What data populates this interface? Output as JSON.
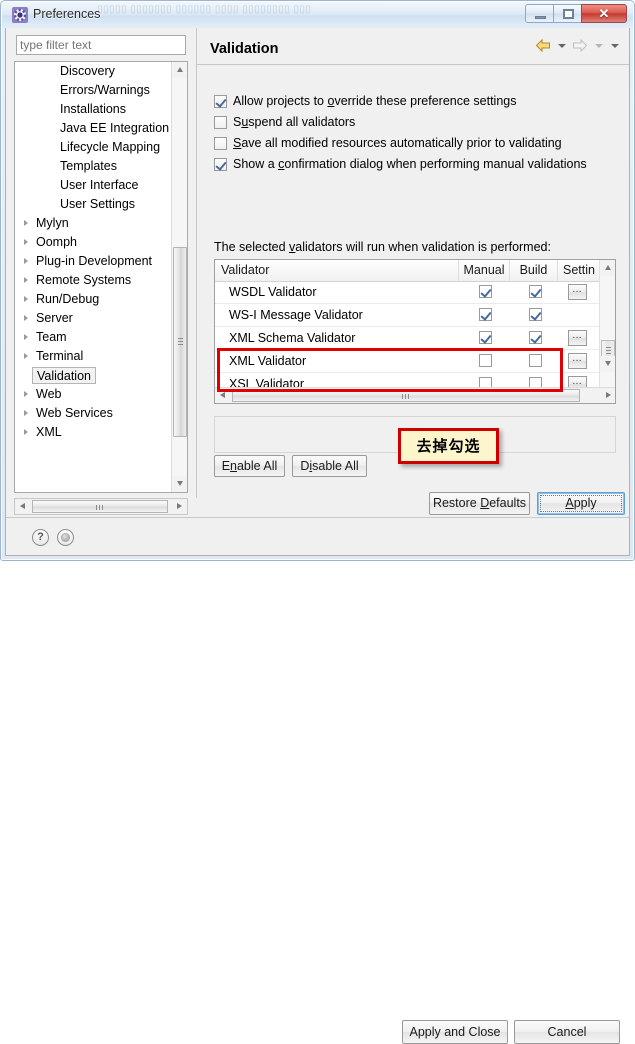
{
  "window": {
    "title": "Preferences",
    "icon": "preferences-gear-icon",
    "ghost_text": "▯▯▯▯▯ ▯▯▯▯▯▯▯ ▯▯▯▯▯▯ ▯▯▯▯ ▯▯▯▯▯▯▯▯ ▯▯▯",
    "controls": {
      "minimize": "minimize-icon",
      "maximize": "maximize-icon",
      "close": "✕"
    },
    "close_color": "#c43a31"
  },
  "filter": {
    "placeholder": "type filter text",
    "value": ""
  },
  "tree": {
    "items": [
      {
        "label": "Discovery",
        "level": "child",
        "expandable": false,
        "selected": false
      },
      {
        "label": "Errors/Warnings",
        "level": "child",
        "expandable": false,
        "selected": false
      },
      {
        "label": "Installations",
        "level": "child",
        "expandable": false,
        "selected": false
      },
      {
        "label": "Java EE Integration",
        "level": "child",
        "expandable": false,
        "selected": false
      },
      {
        "label": "Lifecycle Mapping",
        "level": "child",
        "expandable": false,
        "selected": false
      },
      {
        "label": "Templates",
        "level": "child",
        "expandable": false,
        "selected": false
      },
      {
        "label": "User Interface",
        "level": "child",
        "expandable": false,
        "selected": false
      },
      {
        "label": "User Settings",
        "level": "child",
        "expandable": false,
        "selected": false
      },
      {
        "label": "Mylyn",
        "level": "root",
        "expandable": true,
        "selected": false
      },
      {
        "label": "Oomph",
        "level": "root",
        "expandable": true,
        "selected": false
      },
      {
        "label": "Plug-in Development",
        "level": "root",
        "expandable": true,
        "selected": false
      },
      {
        "label": "Remote Systems",
        "level": "root",
        "expandable": true,
        "selected": false
      },
      {
        "label": "Run/Debug",
        "level": "root",
        "expandable": true,
        "selected": false
      },
      {
        "label": "Server",
        "level": "root",
        "expandable": true,
        "selected": false
      },
      {
        "label": "Team",
        "level": "root",
        "expandable": true,
        "selected": false
      },
      {
        "label": "Terminal",
        "level": "root",
        "expandable": true,
        "selected": false
      },
      {
        "label": "Validation",
        "level": "root",
        "expandable": false,
        "selected": true
      },
      {
        "label": "Web",
        "level": "root",
        "expandable": true,
        "selected": false
      },
      {
        "label": "Web Services",
        "level": "root",
        "expandable": true,
        "selected": false
      },
      {
        "label": "XML",
        "level": "root",
        "expandable": true,
        "selected": false
      }
    ]
  },
  "page": {
    "title": "Validation",
    "nav": {
      "back": "back-arrow-icon",
      "back_caret": "chevron-down-icon",
      "forward": "forward-arrow-icon",
      "forward_caret": "chevron-down-icon",
      "menu_caret": "chevron-down-icon"
    }
  },
  "options": [
    {
      "label_pre": "Allow projects to ",
      "mnemonic": "o",
      "label_post": "verride these preference settings",
      "checked": true,
      "disabled": false
    },
    {
      "label_pre": "S",
      "mnemonic": "u",
      "label_post": "spend all validators",
      "checked": false,
      "disabled": false
    },
    {
      "label_pre": "",
      "mnemonic": "S",
      "label_post": "ave all modified resources automatically prior to validating",
      "checked": false,
      "disabled": false
    },
    {
      "label_pre": "Show a ",
      "mnemonic": "c",
      "label_post": "onfirmation dialog when performing manual validations",
      "checked": true,
      "disabled": false
    }
  ],
  "table": {
    "caption_pre": "The selected ",
    "caption_mnemonic": "v",
    "caption_post": "alidators will run when validation is performed:",
    "columns": [
      "Validator",
      "Manual",
      "Build",
      "Settin"
    ],
    "rows": [
      {
        "name": "WSDL Validator",
        "manual": true,
        "build": true,
        "settings": true,
        "highlighted": false
      },
      {
        "name": "WS-I Message Validator",
        "manual": true,
        "build": true,
        "settings": false,
        "highlighted": false
      },
      {
        "name": "XML Schema Validator",
        "manual": true,
        "build": true,
        "settings": true,
        "highlighted": false
      },
      {
        "name": "XML Validator",
        "manual": false,
        "build": false,
        "settings": true,
        "highlighted": true
      },
      {
        "name": "XSL Validator",
        "manual": false,
        "build": false,
        "settings": true,
        "highlighted": true
      }
    ],
    "settings_glyph": "…"
  },
  "buttons": {
    "enable_all_pre": "E",
    "enable_all_mnemonic": "n",
    "enable_all_post": "able All",
    "disable_all_pre": "D",
    "disable_all_mnemonic": "i",
    "disable_all_post": "sable All",
    "restore_pre": "Restore ",
    "restore_mnemonic": "D",
    "restore_post": "efaults",
    "apply_pre": "",
    "apply_mnemonic": "A",
    "apply_post": "pply",
    "apply_and_close": "Apply and Close",
    "cancel": "Cancel"
  },
  "bottom": {
    "help_icon": "?",
    "shell_icon": "shell-circle-icon"
  },
  "annotation": {
    "text": "去掉勾选",
    "border_color": "#cc0000",
    "background_color": "#fdf6cc"
  },
  "highlight": {
    "color": "#e00000",
    "target_rows": [
      "XML Validator",
      "XSL Validator"
    ]
  }
}
